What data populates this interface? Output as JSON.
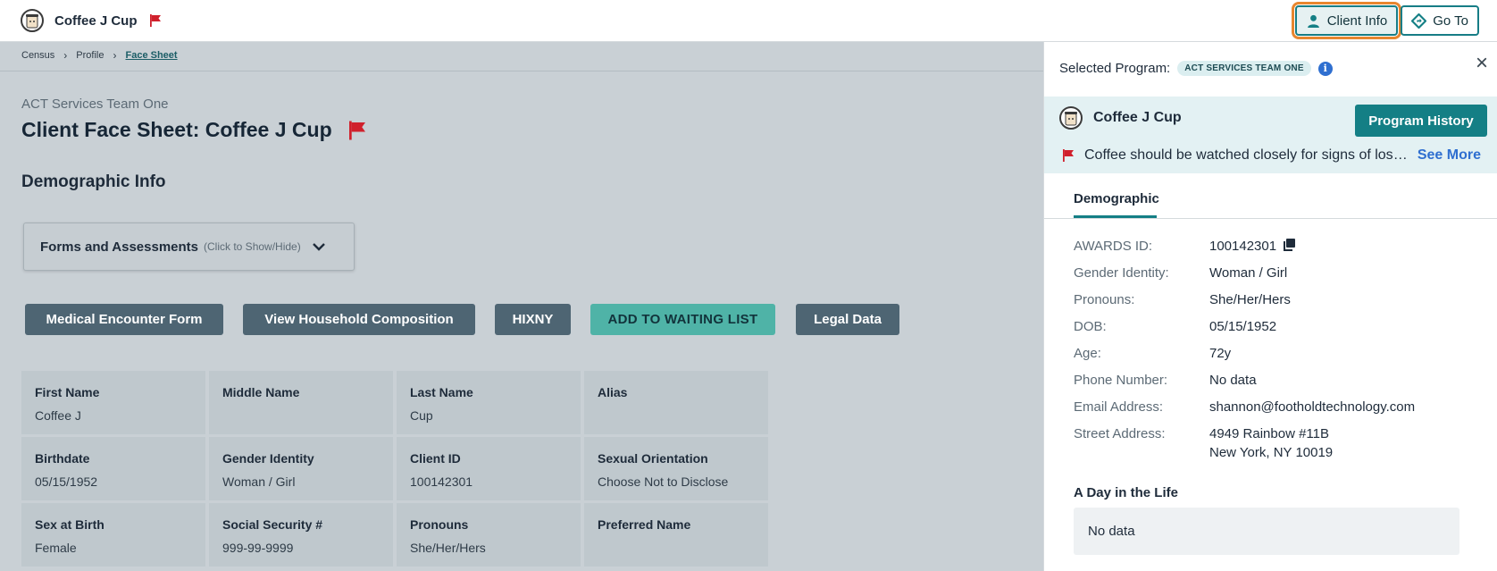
{
  "header": {
    "client_name": "Coffee J Cup",
    "client_info_label": "Client Info",
    "go_to_label": "Go To"
  },
  "breadcrumb": {
    "items": [
      "Census",
      "Profile",
      "Face Sheet"
    ]
  },
  "main": {
    "program_name": "ACT Services Team One",
    "page_title": "Client Face Sheet: Coffee J Cup",
    "section_title": "Demographic Info",
    "forms_toggle": {
      "label": "Forms and Assessments",
      "hint": "(Click to Show/Hide)"
    },
    "actions": [
      "Medical Encounter Form",
      "View Household Composition",
      "HIXNY",
      "ADD TO WAITING LIST",
      "Legal Data"
    ],
    "grid": [
      [
        {
          "label": "First Name",
          "value": "Coffee J"
        },
        {
          "label": "Middle Name",
          "value": ""
        },
        {
          "label": "Last Name",
          "value": "Cup"
        },
        {
          "label": "Alias",
          "value": ""
        }
      ],
      [
        {
          "label": "Birthdate",
          "value": "05/15/1952"
        },
        {
          "label": "Gender Identity",
          "value": "Woman / Girl"
        },
        {
          "label": "Client ID",
          "value": "100142301"
        },
        {
          "label": "Sexual Orientation",
          "value": "Choose Not to Disclose"
        }
      ],
      [
        {
          "label": "Sex at Birth",
          "value": "Female"
        },
        {
          "label": "Social Security #",
          "value": "999-99-9999"
        },
        {
          "label": "Pronouns",
          "value": "She/Her/Hers"
        },
        {
          "label": "Preferred Name",
          "value": ""
        }
      ]
    ]
  },
  "panel": {
    "selected_program_label": "Selected Program:",
    "program_badge": "ACT SERVICES TEAM ONE",
    "info_glyph": "i",
    "close_glyph": "×",
    "client_name": "Coffee J Cup",
    "program_history_label": "Program History",
    "alert_text": "Coffee should be watched closely for signs of loss of appetite",
    "see_more_label": "See More",
    "tab_label": "Demographic",
    "fields": [
      {
        "label": "AWARDS ID:",
        "value": "100142301",
        "value2": ""
      },
      {
        "label": "Gender Identity:",
        "value": "Woman / Girl",
        "value2": ""
      },
      {
        "label": "Pronouns:",
        "value": "She/Her/Hers",
        "value2": ""
      },
      {
        "label": "DOB:",
        "value": "05/15/1952",
        "value2": ""
      },
      {
        "label": "Age:",
        "value": "72y",
        "value2": ""
      },
      {
        "label": "Phone Number:",
        "value": "No data",
        "value2": ""
      },
      {
        "label": "Email Address:",
        "value": "shannon@footholdtechnology.com",
        "value2": ""
      },
      {
        "label": "Street Address:",
        "value": "4949 Rainbow #11B",
        "value2": "New York, NY 10019"
      }
    ],
    "day_in_life_title": "A Day in the Life",
    "day_in_life_value": "No data"
  },
  "colors": {
    "accent": "#147f85",
    "flag": "#d0202c",
    "highlight": "#e8862f",
    "link": "#2f6fd0"
  }
}
